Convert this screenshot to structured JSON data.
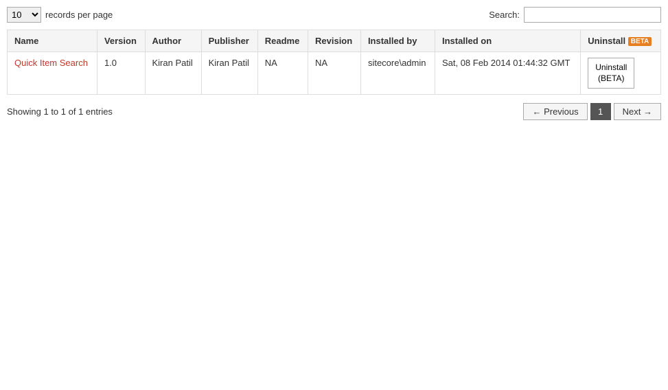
{
  "topBar": {
    "recordsPerPage": "10",
    "recordsPerPageLabel": "records per page",
    "searchLabel": "Search:",
    "searchValue": ""
  },
  "table": {
    "columns": [
      {
        "key": "name",
        "label": "Name"
      },
      {
        "key": "version",
        "label": "Version"
      },
      {
        "key": "author",
        "label": "Author"
      },
      {
        "key": "publisher",
        "label": "Publisher"
      },
      {
        "key": "readme",
        "label": "Readme"
      },
      {
        "key": "revision",
        "label": "Revision"
      },
      {
        "key": "installed_by",
        "label": "Installed by"
      },
      {
        "key": "installed_on",
        "label": "Installed on"
      },
      {
        "key": "uninstall",
        "label": "Uninstall"
      },
      {
        "key": "beta",
        "label": "BETA"
      }
    ],
    "rows": [
      {
        "name": "Quick Item Search",
        "version": "1.0",
        "author": "Kiran Patil",
        "publisher": "Kiran Patil",
        "readme": "NA",
        "revision": "NA",
        "installed_by": "sitecore\\admin",
        "installed_on": "Sat, 08 Feb 2014 01:44:32 GMT",
        "uninstall_label": "Uninstall\n(BETA)"
      }
    ]
  },
  "footer": {
    "showing": "Showing 1 to 1 of 1 entries",
    "prev_label": "← Previous",
    "next_label": "Next →",
    "current_page": "1"
  }
}
